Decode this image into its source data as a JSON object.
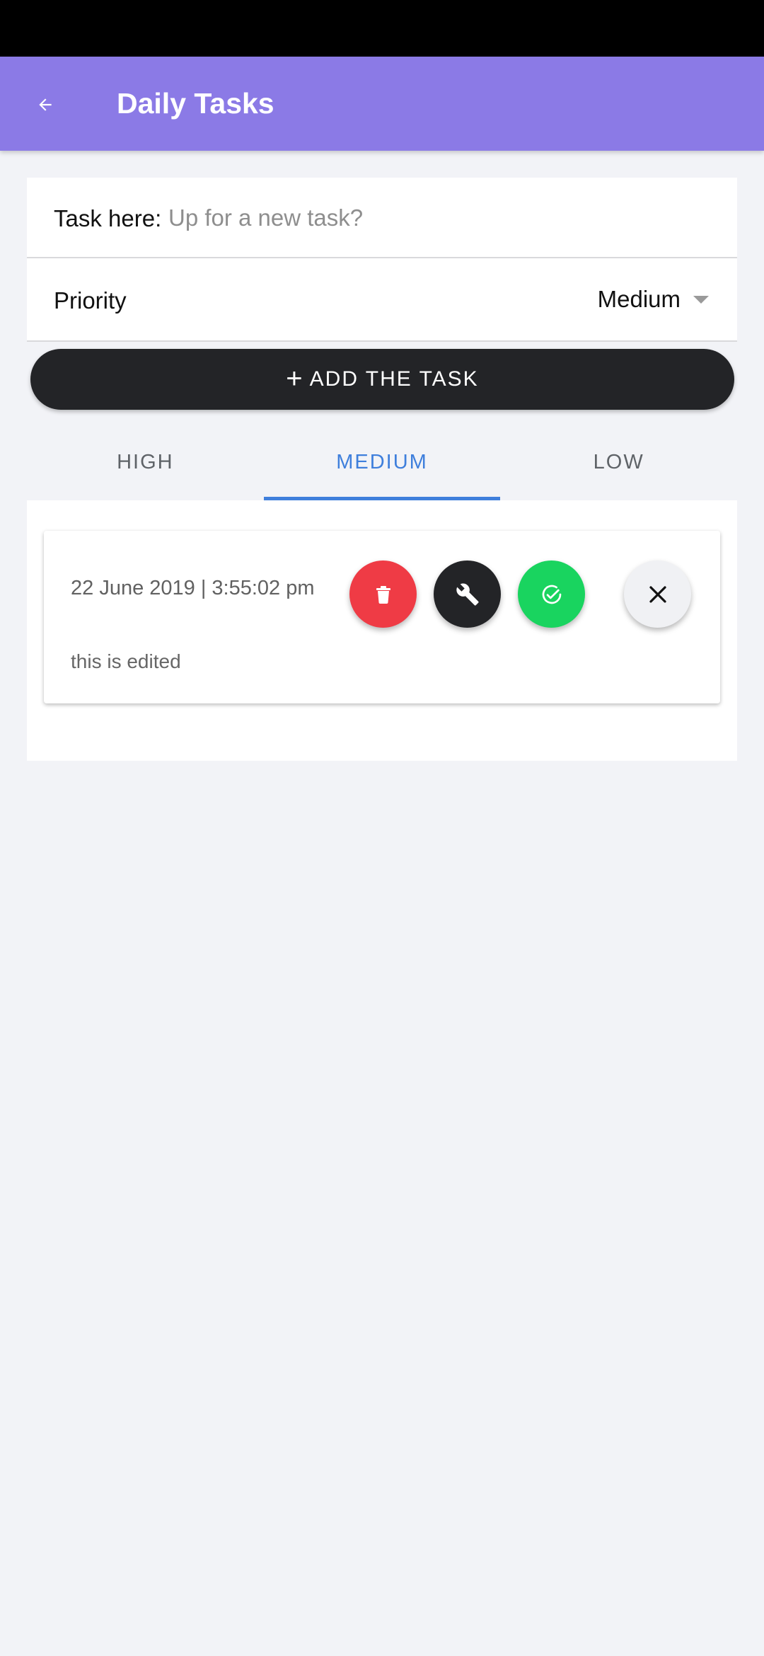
{
  "app_bar": {
    "title": "Daily Tasks",
    "back_icon": "arrow-left-icon",
    "color": "#8b7ae6"
  },
  "form": {
    "task_label": "Task here:",
    "task_placeholder": "Up for a new task?",
    "task_value": "",
    "priority_label": "Priority",
    "priority_value": "Medium"
  },
  "add_button": {
    "label": "ADD THE TASK",
    "icon": "plus-icon"
  },
  "tabs": [
    {
      "label": "HIGH",
      "active": false
    },
    {
      "label": "MEDIUM",
      "active": true
    },
    {
      "label": "LOW",
      "active": false
    }
  ],
  "tasks": [
    {
      "date": "22 June 2019 | 3:55:02 pm",
      "text": "this is edited",
      "actions": [
        "trash-icon",
        "wrench-icon",
        "check-circle-icon",
        "close-icon"
      ]
    }
  ],
  "colors": {
    "accent": "#3f7fdc",
    "delete": "#ef3b45",
    "edit": "#232427",
    "done": "#19d45f",
    "background": "#f2f3f7"
  }
}
